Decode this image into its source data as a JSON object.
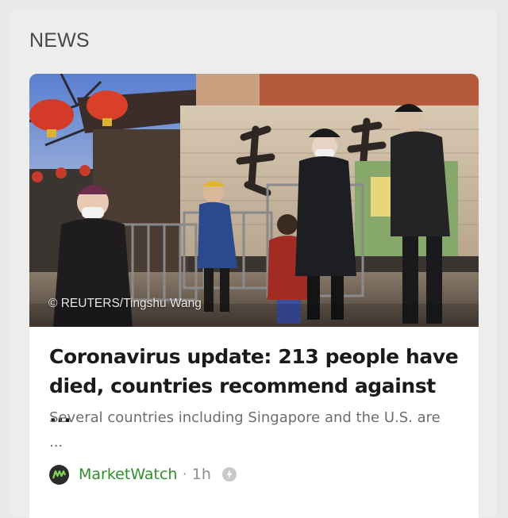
{
  "section": {
    "title": "NEWS"
  },
  "article": {
    "photo_credit": "© REUTERS/Tingshu Wang",
    "headline": "Coronavirus update: 213 people have died, countries recommend against ...",
    "summary": "Several countries including Singapore and the U.S. are ...",
    "source": "MarketWatch",
    "separator": "·",
    "age": "1h"
  },
  "icons": {
    "source_logo": "marketwatch-logo",
    "flash": "lightning-bolt-icon"
  },
  "colors": {
    "background": "#e9e9eb",
    "card": "#ffffff",
    "source_name": "#2f8f2a",
    "meta": "#8e8e93"
  }
}
